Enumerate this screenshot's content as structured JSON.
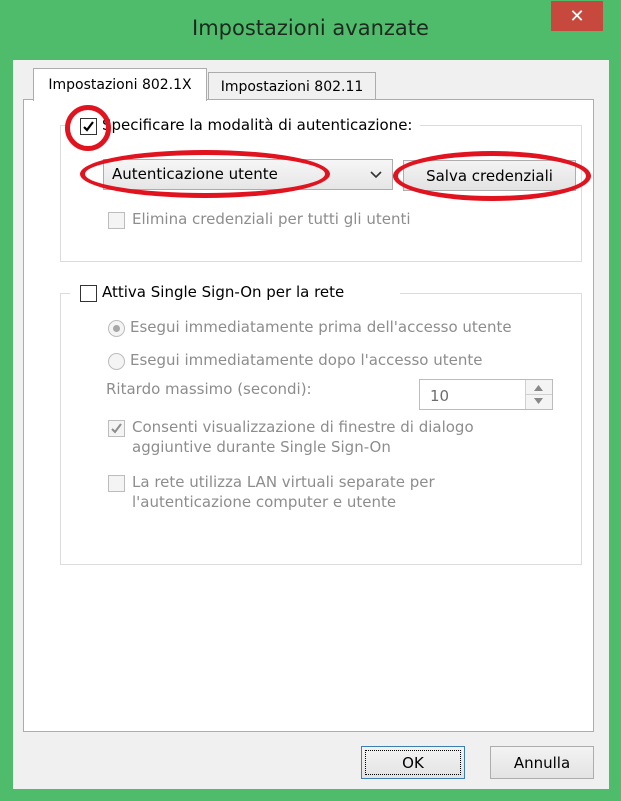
{
  "window": {
    "title": "Impostazioni avanzate",
    "close_glyph": "✕"
  },
  "tabs": [
    {
      "label": "Impostazioni 802.1X",
      "active": true
    },
    {
      "label": "Impostazioni 802.11",
      "active": false
    }
  ],
  "auth_group": {
    "checkbox_label": "Specificare la modalità di autenticazione:",
    "checked": true,
    "mode_selected": "Autenticazione utente",
    "save_button": "Salva credenziali",
    "delete_label": "Elimina credenziali per tutti gli utenti"
  },
  "sso_group": {
    "checkbox_label": "Attiva Single Sign-On per la rete",
    "radio_before": "Esegui immediatamente prima dell'accesso utente",
    "radio_after": "Esegui immediatamente dopo l'accesso utente",
    "delay_label": "Ritardo massimo (secondi):",
    "delay_value": "10",
    "allow_dialogs_line1": "Consenti visualizzazione di finestre di dialogo",
    "allow_dialogs_line2": "aggiuntive durante Single Sign-On",
    "vlan_line1": "La rete utilizza LAN virtuali separate per",
    "vlan_line2": "l'autenticazione computer e utente"
  },
  "footer": {
    "ok": "OK",
    "cancel": "Annulla"
  },
  "colors": {
    "title_bar": "#4fbc6c",
    "close_button": "#c7493e",
    "annotation": "#e0131f"
  }
}
